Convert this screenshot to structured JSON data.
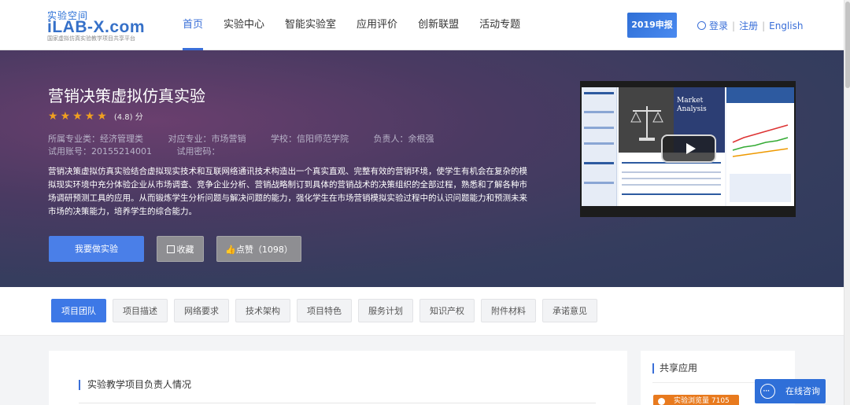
{
  "header": {
    "logo_small": "实验空间",
    "logo_main": "iLAB-X.com",
    "logo_sub": "国家虚拟仿真实验教学项目共享平台",
    "nav": [
      "首页",
      "实验中心",
      "智能实验室",
      "应用评价",
      "创新联盟",
      "活动专题"
    ],
    "badge": "2019申报",
    "login": "登录",
    "register": "注册",
    "language": "English"
  },
  "hero": {
    "title": "营销决策虚拟仿真实验",
    "rating": 4.8,
    "score_text": "(4.8) 分",
    "meta1": [
      "所属专业类：经济管理类",
      "对应专业：市场营销",
      "学校：信阳师范学院",
      "负责人：余根强"
    ],
    "meta2": [
      "试用账号：20155214001",
      "试用密码："
    ],
    "description": "营销决策虚拟仿真实验结合虚拟现实技术和互联网络通讯技术构造出一个真实直观、完整有效的营销环境，使学生有机会在复杂的模拟现实环境中充分体验企业从市场调查、竞争企业分析、营销战略制订到具体的营销战术的决策组织的全部过程，熟悉和了解各种市场调研预测工具的应用。从而锻炼学生分析问题与解决问题的能力，强化学生在市场营销模拟实验过程中的认识问题能力和预测未来市场的决策能力，培养学生的综合能力。",
    "btn_start": "我要做实验",
    "btn_fav": "收藏",
    "btn_like": "点赞（1098）",
    "video_title": "Market Analysis"
  },
  "tabs": [
    "项目团队",
    "项目描述",
    "网络要求",
    "技术架构",
    "项目特色",
    "服务计划",
    "知识产权",
    "附件材料",
    "承诺意见"
  ],
  "content": {
    "section_title": "实验教学项目负责人情况"
  },
  "side": {
    "title": "共享应用",
    "views": "实验浏览量 7105"
  },
  "consult": "在线咨询",
  "colors": {
    "accent": "#3a6fd8",
    "star": "#f0a020",
    "views_tag": "#e87a1e"
  }
}
